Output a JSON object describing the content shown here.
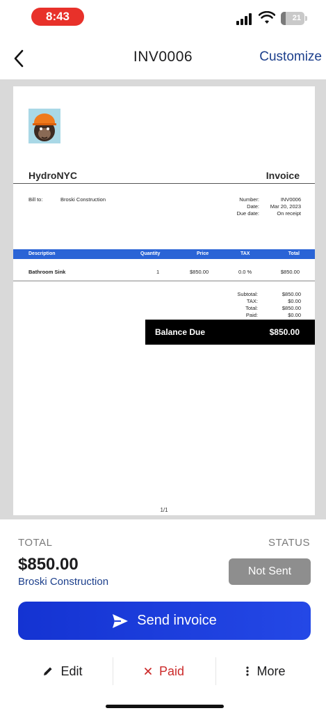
{
  "status_bar": {
    "time": "8:43",
    "battery": "21",
    "battery_level": 0.21
  },
  "nav": {
    "back_icon": "chevron-left-icon",
    "title": "INV0006",
    "customize_label": "Customize"
  },
  "invoice": {
    "business_name": "HydroNYC",
    "doc_title": "Invoice",
    "bill_to_label": "Bill to:",
    "bill_to_name": "Broski Construction",
    "meta_labels": [
      "Number:",
      "Date:",
      "Due date:"
    ],
    "meta_values": [
      "INV0006",
      "Mar 20, 2023",
      "On receipt"
    ],
    "table_headers": [
      "Description",
      "Quantity",
      "Price",
      "TAX",
      "Total"
    ],
    "line_items": [
      {
        "description": "Bathroom Sink",
        "quantity": "1",
        "price": "$850.00",
        "tax": "0.0 %",
        "total": "$850.00"
      }
    ],
    "totals_labels": [
      "Subtotal:",
      "TAX:",
      "Total:",
      "Paid:"
    ],
    "totals_values": [
      "$850.00",
      "$0.00",
      "$850.00",
      "$0.00"
    ],
    "balance_label": "Balance Due",
    "balance_value": "$850.00",
    "page_indicator": "1/1"
  },
  "summary": {
    "total_label": "TOTAL",
    "status_label": "STATUS",
    "total_amount": "$850.00",
    "client_name": "Broski Construction",
    "status_value": "Not Sent"
  },
  "actions": {
    "send_label": "Send invoice",
    "edit_label": "Edit",
    "paid_label": "Paid",
    "more_label": "More"
  },
  "colors": {
    "accent": "#1c3f8c",
    "send_button": "#1f40df",
    "table_header": "#2a64d6",
    "paid_red": "#cc2b2b",
    "status_badge": "#8e8e8e",
    "time_pill": "#e8312a"
  }
}
